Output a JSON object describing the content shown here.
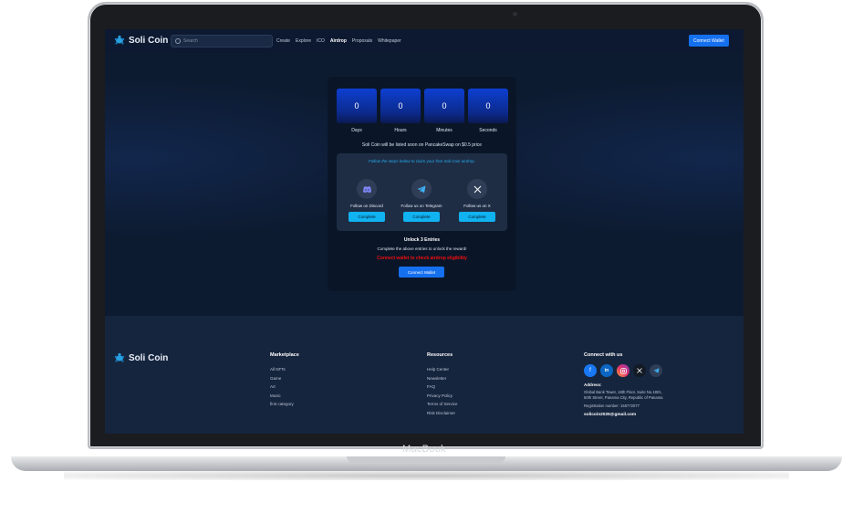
{
  "device": {
    "label": "MacBook"
  },
  "nav": {
    "brand": "Soli Coin",
    "search_placeholder": "Search",
    "links": [
      "Create",
      "Explore",
      "ICO",
      "Airdrop",
      "Proposals",
      "Whitepaper"
    ],
    "active_link": "Airdrop",
    "connect_label": "Connect Wallet"
  },
  "countdown": {
    "days": "0",
    "hours": "0",
    "minutes": "0",
    "seconds": "0",
    "labels": {
      "days": "Days",
      "hours": "Hours",
      "minutes": "Minutes",
      "seconds": "Seconds"
    }
  },
  "listing_note": "Soli Coin will be listed soon on PancakeSwap on $0.5 price",
  "steps": {
    "title": "Follow the steps below to claim your free Soli Coin airdrop.",
    "tasks": [
      {
        "label": "Follow on Discord",
        "icon": "discord-icon",
        "button": "Complete"
      },
      {
        "label": "Follow us on Telegram",
        "icon": "telegram-icon",
        "button": "Complete"
      },
      {
        "label": "Follow us on X",
        "icon": "x-icon",
        "button": "Complete"
      }
    ]
  },
  "unlock": {
    "title": "Unlock 3 Entries",
    "subtitle": "Complete the above entries to unlock the reward!",
    "warning": "Connect wallet to check airdrop eligibility",
    "connect_label": "Connect Wallet"
  },
  "footer": {
    "brand": "Soli Coin",
    "marketplace": {
      "heading": "Marketplace",
      "links": [
        "All NFTs",
        "Game",
        "Art",
        "Music",
        "first category"
      ]
    },
    "resources": {
      "heading": "Resources",
      "links": [
        "Help Center",
        "Newsletter",
        "FAQ",
        "Privacy Policy",
        "Terms of Service",
        "Risk Disclaimer"
      ]
    },
    "connect": {
      "heading": "Connect with us",
      "address_title": "Address:",
      "address": "Global Bank Tower, 18th Floor, Suite No.1801, 50th Street, Panama City, Republic of Panama",
      "registration": "Registration number: 155772077",
      "email": "solicoin2026@gmail.com"
    }
  },
  "colors": {
    "accent": "#1570ef",
    "cyan": "#10b2f0",
    "warning": "#f20d0d",
    "background": "#0d1b31"
  }
}
